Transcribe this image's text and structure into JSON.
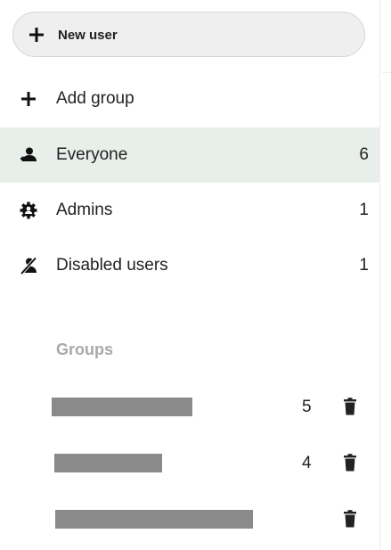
{
  "new_user": {
    "label": "New user",
    "icon": "plus-icon"
  },
  "nav": {
    "add_group": {
      "label": "Add group",
      "icon": "plus-icon"
    },
    "everyone": {
      "label": "Everyone",
      "count": "6",
      "icon": "user-icon"
    },
    "admins": {
      "label": "Admins",
      "count": "1",
      "icon": "gear-icon"
    },
    "disabled": {
      "label": "Disabled users",
      "count": "1",
      "icon": "user-disabled-icon"
    }
  },
  "groups": {
    "caption": "Groups",
    "items": [
      {
        "count": "5",
        "icon": "trash-icon"
      },
      {
        "count": "4",
        "icon": "trash-icon"
      },
      {
        "count": "",
        "icon": "trash-icon"
      }
    ]
  },
  "colors": {
    "active_bg": "#e8efea",
    "button_bg": "#efefef",
    "caption": "#a9a9a9",
    "redaction": "#8a8a8a"
  }
}
